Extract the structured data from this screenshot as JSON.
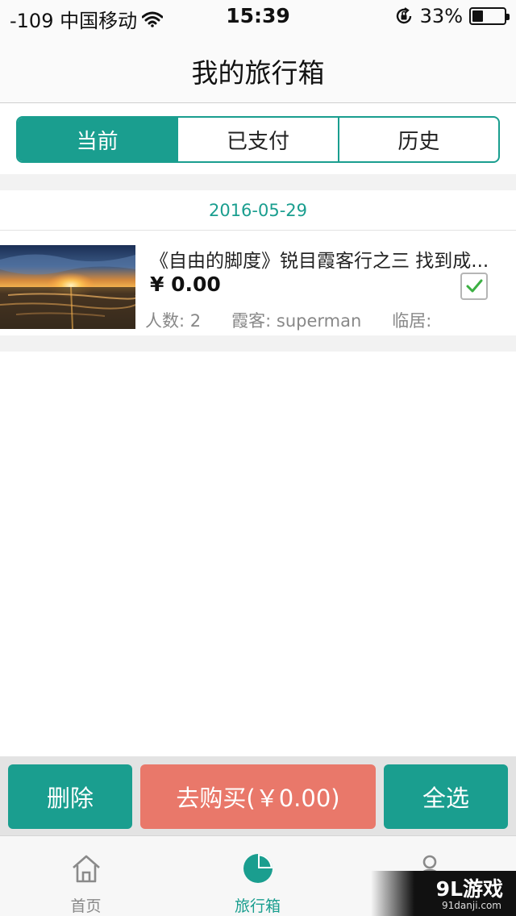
{
  "status_bar": {
    "carrier": "-109 中国移动",
    "time": "15:39",
    "battery": "33%",
    "battery_level": 0.33,
    "icons": [
      "wifi-icon",
      "rotation-lock-icon",
      "battery-icon"
    ]
  },
  "nav": {
    "title": "我的旅行箱"
  },
  "tabs_segment": {
    "items": [
      {
        "label": "当前",
        "active": true
      },
      {
        "label": "已支付",
        "active": false
      },
      {
        "label": "历史",
        "active": false
      }
    ]
  },
  "list": {
    "date": "2016-05-29",
    "items": [
      {
        "title": "《自由的脚度》锐目霞客行之三 找到成...",
        "price": "¥ 0.00",
        "people": "人数: 2",
        "guide": "霞客: superman",
        "residence": "临居:",
        "checked": true
      }
    ]
  },
  "actions": {
    "delete_label": "删除",
    "buy_label": "去购买(￥0.00)",
    "select_all_label": "全选"
  },
  "tab_bar": {
    "items": [
      {
        "label": "首页",
        "icon": "home-icon",
        "active": false
      },
      {
        "label": "旅行箱",
        "icon": "pie-chart-icon",
        "active": true
      },
      {
        "label": "",
        "icon": "user-icon",
        "active": false
      }
    ]
  },
  "watermark": {
    "text": "9L游戏",
    "sub": "91danji.com"
  },
  "colors": {
    "accent": "#1a9e8f",
    "buy": "#e9786a",
    "checkmark": "#3cb043"
  }
}
